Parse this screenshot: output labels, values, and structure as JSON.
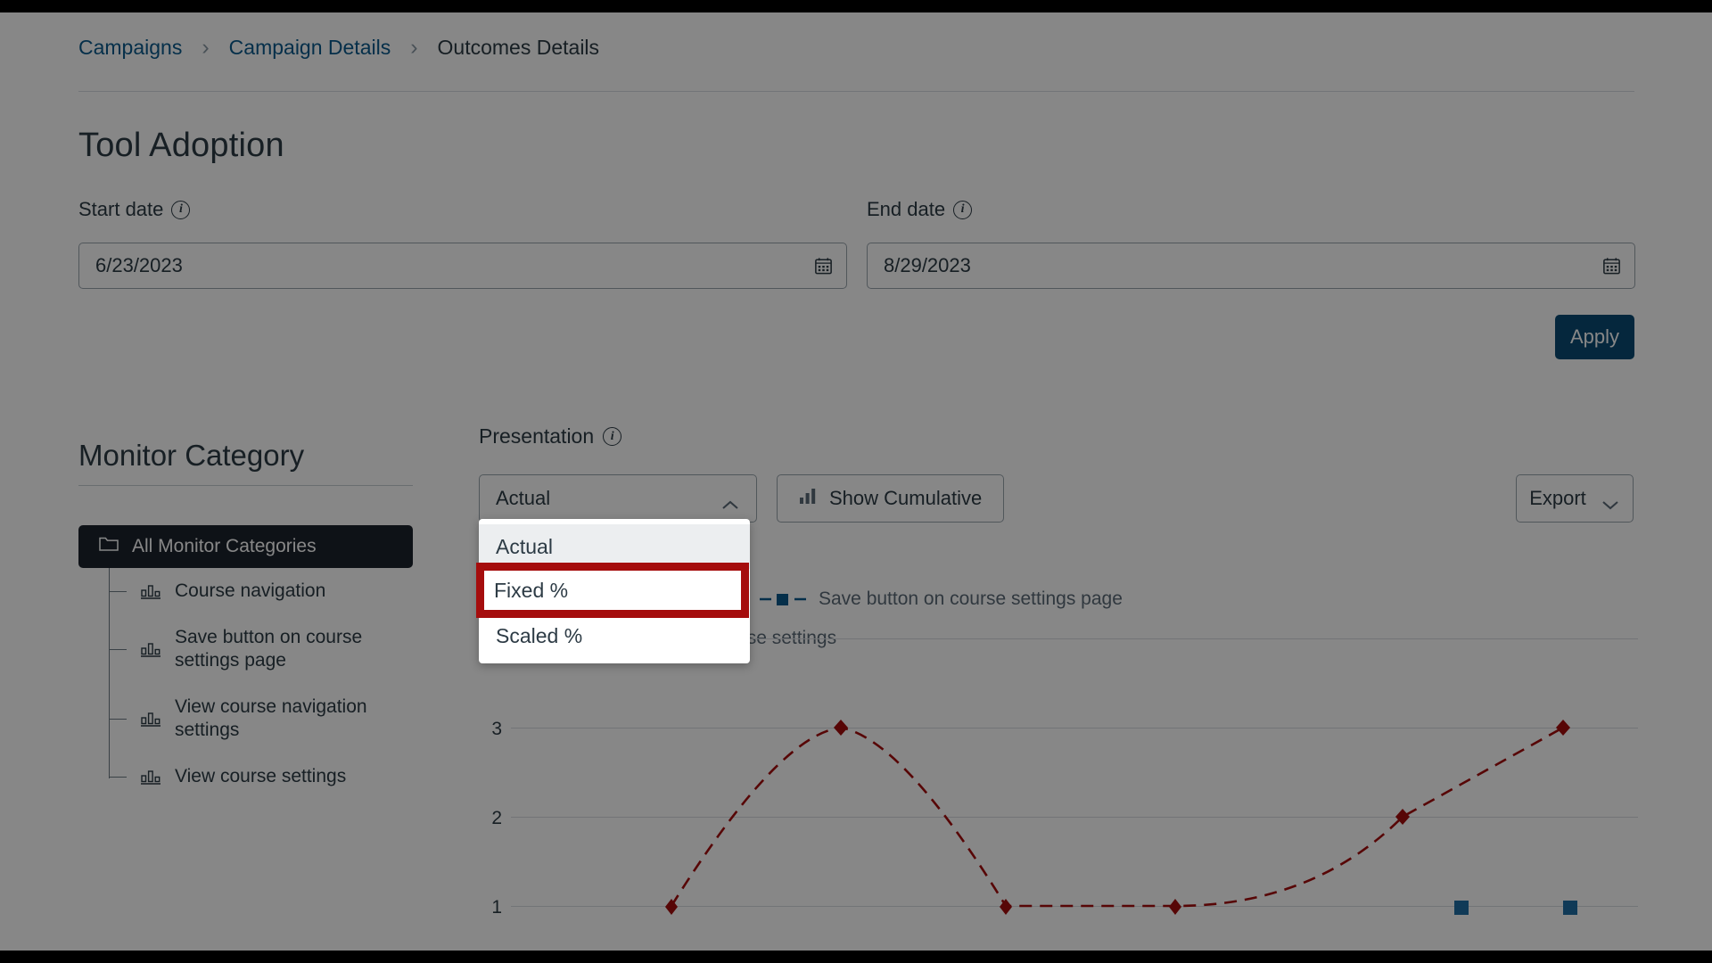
{
  "breadcrumb": {
    "items": [
      {
        "label": "Campaigns",
        "current": false
      },
      {
        "label": "Campaign Details",
        "current": false
      },
      {
        "label": "Outcomes Details",
        "current": true
      }
    ],
    "separator": "›"
  },
  "page": {
    "title": "Tool Adoption"
  },
  "filters": {
    "start_label": "Start date",
    "start_value": "6/23/2023",
    "end_label": "End date",
    "end_value": "8/29/2023",
    "apply_label": "Apply",
    "info_glyph": "i"
  },
  "sidebar": {
    "title": "Monitor Category",
    "selected": "All Monitor Categories",
    "items": [
      {
        "label": "Course navigation"
      },
      {
        "label": "Save button on course settings page"
      },
      {
        "label": "View course navigation settings"
      },
      {
        "label": "View course settings"
      }
    ]
  },
  "toolbar": {
    "presentation_label": "Presentation",
    "selected_presentation": "Actual",
    "cumulative_label": "Show Cumulative",
    "export_label": "Export"
  },
  "dropdown": {
    "open": true,
    "options": [
      {
        "label": "Actual",
        "state": "hovered"
      },
      {
        "label": "Fixed %",
        "state": "highlighted"
      },
      {
        "label": "Scaled %",
        "state": "normal"
      }
    ],
    "highlight_color": "#a50d0d"
  },
  "chart_data": {
    "type": "line",
    "title": "",
    "xlabel": "",
    "ylabel": "",
    "ylim": [
      0,
      4
    ],
    "yticks": [
      "4",
      "3",
      "2",
      "1"
    ],
    "grid": true,
    "legend_position": "top",
    "series": [
      {
        "name": "Course navigation",
        "color": "#a50d0d",
        "marker": "diamond",
        "dash": "dashed",
        "values": [
          1,
          3,
          1,
          1,
          2,
          3
        ]
      },
      {
        "name": "Save button on course settings page",
        "color": "#0a5a8c",
        "marker": "square",
        "dash": "dashed",
        "values": [
          null,
          null,
          null,
          null,
          1,
          1
        ]
      },
      {
        "name": "View course navigation settings",
        "color": "#0a5a8c",
        "marker": "circle",
        "dash": "dashed",
        "values": []
      },
      {
        "name": "View course settings",
        "color": "#55207a",
        "marker": "triangle",
        "dash": "dashed",
        "values": []
      }
    ],
    "legend": [
      {
        "label": "View course navigation settings",
        "color": "#0a5a8c",
        "marker": "square",
        "occluded_text": "ettings"
      },
      {
        "label": "Save button on course settings page",
        "color": "#0a5a8c",
        "marker": "square"
      },
      {
        "label": "View course settings",
        "color": "#55207a",
        "marker": "triangle"
      }
    ]
  }
}
